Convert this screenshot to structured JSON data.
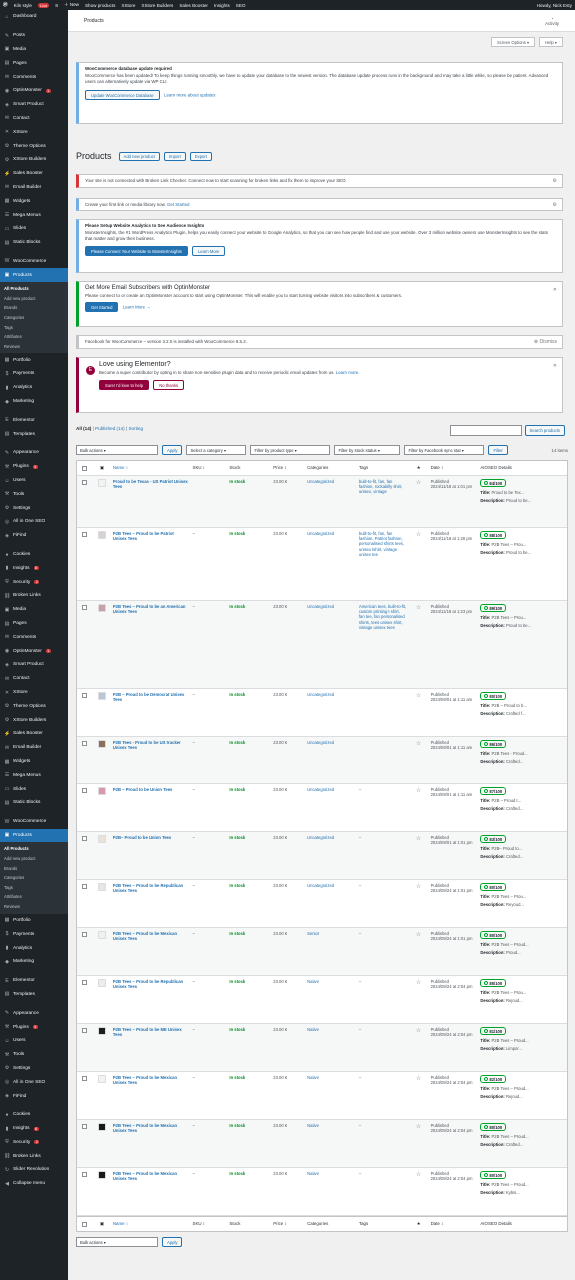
{
  "adminbar": {
    "site": "Kiln style",
    "live": "Live",
    "counts": "8",
    "new": "New",
    "show": "Show products",
    "xstore": "XStore",
    "xstore_builders": "XStore Builders",
    "sales_booster": "Sales Booster",
    "insights": "Insights",
    "seo": "SEO",
    "howdy": "Howdy, Nick Esty"
  },
  "sidebar": {
    "items": [
      {
        "icon": "dashboard-icon",
        "glyph": "⌂",
        "label": "Dashboard"
      },
      {
        "sep": true
      },
      {
        "icon": "pin-icon",
        "glyph": "✎",
        "label": "Posts"
      },
      {
        "icon": "media-icon",
        "glyph": "▣",
        "label": "Media"
      },
      {
        "icon": "pages-icon",
        "glyph": "▤",
        "label": "Pages"
      },
      {
        "icon": "comments-icon",
        "glyph": "✉",
        "label": "Comments"
      },
      {
        "icon": "optinmonster-icon",
        "glyph": "◉",
        "label": "OptinMonster",
        "count": "1"
      },
      {
        "icon": "smart-product-icon",
        "glyph": "◈",
        "label": "Smart Product"
      },
      {
        "icon": "contact-icon",
        "glyph": "✉",
        "label": "Contact"
      },
      {
        "icon": "xstore-icon",
        "glyph": "✕",
        "label": "XStore"
      },
      {
        "icon": "theme-options-icon",
        "glyph": "⚙",
        "label": "Theme Options"
      },
      {
        "icon": "xstore-builders-icon",
        "glyph": "⚙",
        "label": "XStore Builders"
      },
      {
        "icon": "sales-booster-icon",
        "glyph": "⚡",
        "label": "Sales Booster"
      },
      {
        "icon": "email-builder-icon",
        "glyph": "✉",
        "label": "Email Builder"
      },
      {
        "icon": "widgets-icon",
        "glyph": "▦",
        "label": "Widgets"
      },
      {
        "icon": "mega-menu-icon",
        "glyph": "☰",
        "label": "Mega Menus"
      },
      {
        "icon": "slides-icon",
        "glyph": "▭",
        "label": "Slides"
      },
      {
        "icon": "static-blocks-icon",
        "glyph": "▤",
        "label": "Static Blocks"
      },
      {
        "sep": true
      },
      {
        "icon": "woocommerce-icon",
        "glyph": "W",
        "label": "WooCommerce"
      },
      {
        "icon": "products-icon",
        "glyph": "▣",
        "label": "Products",
        "active": true
      }
    ],
    "products_sub": [
      "All Products",
      "Add new product",
      "Brands",
      "Categories",
      "Tags",
      "Attributes",
      "Reviews"
    ],
    "items2": [
      {
        "icon": "portfolio-icon",
        "glyph": "▦",
        "label": "Portfolio"
      },
      {
        "icon": "payments-icon",
        "glyph": "$",
        "label": "Payments"
      },
      {
        "icon": "analytics-icon",
        "glyph": "▮",
        "label": "Analytics"
      },
      {
        "icon": "marketing-icon",
        "glyph": "◆",
        "label": "Marketing"
      },
      {
        "sep": true
      },
      {
        "icon": "elementor-icon",
        "glyph": "E",
        "label": "Elementor"
      },
      {
        "icon": "templates-icon",
        "glyph": "▤",
        "label": "Templates"
      },
      {
        "sep": true
      },
      {
        "icon": "appearance-icon",
        "glyph": "✎",
        "label": "Appearance"
      },
      {
        "icon": "plugins-icon",
        "glyph": "⚒",
        "label": "Plugins",
        "count": "5"
      },
      {
        "icon": "users-icon",
        "glyph": "☺",
        "label": "Users"
      },
      {
        "icon": "tools-icon",
        "glyph": "⚒",
        "label": "Tools"
      },
      {
        "icon": "settings-icon",
        "glyph": "⚙",
        "label": "Settings"
      },
      {
        "icon": "seo-icon",
        "glyph": "◎",
        "label": "All in One SEO"
      },
      {
        "icon": "fifufind-icon",
        "glyph": "◈",
        "label": "FiFind"
      },
      {
        "sep": true
      },
      {
        "icon": "cookies-icon",
        "glyph": "●",
        "label": "Cookies"
      },
      {
        "icon": "insights-icon",
        "glyph": "▮",
        "label": "Insights",
        "count": "8"
      },
      {
        "icon": "security-icon",
        "glyph": "⛨",
        "label": "Security",
        "count": "2"
      },
      {
        "icon": "broken-links-icon",
        "glyph": "⛓",
        "label": "Broken Links"
      },
      {
        "icon": "media2-icon",
        "glyph": "▣",
        "label": "Media"
      },
      {
        "icon": "pages2-icon",
        "glyph": "▤",
        "label": "Pages"
      },
      {
        "icon": "comments2-icon",
        "glyph": "✉",
        "label": "Comments"
      },
      {
        "icon": "optinmonster2-icon",
        "glyph": "◉",
        "label": "OptinMonster",
        "count": "1"
      },
      {
        "icon": "smart-product2-icon",
        "glyph": "◈",
        "label": "Smart Product"
      },
      {
        "icon": "contact2-icon",
        "glyph": "✉",
        "label": "Contact"
      },
      {
        "icon": "xstore2-icon",
        "glyph": "✕",
        "label": "XStore"
      },
      {
        "icon": "theme-options2-icon",
        "glyph": "⚙",
        "label": "Theme Options"
      },
      {
        "icon": "xstore-builders2-icon",
        "glyph": "⚙",
        "label": "XStore Builders"
      },
      {
        "icon": "sales-booster2-icon",
        "glyph": "⚡",
        "label": "Sales Booster"
      },
      {
        "icon": "email-builder2-icon",
        "glyph": "✉",
        "label": "Email Builder"
      },
      {
        "icon": "widgets2-icon",
        "glyph": "▦",
        "label": "Widgets"
      },
      {
        "icon": "mega-menu2-icon",
        "glyph": "☰",
        "label": "Mega Menus"
      },
      {
        "icon": "slides2-icon",
        "glyph": "▭",
        "label": "Slides"
      },
      {
        "icon": "static-blocks2-icon",
        "glyph": "▤",
        "label": "Static Blocks"
      },
      {
        "sep": true
      },
      {
        "icon": "woocommerce2-icon",
        "glyph": "W",
        "label": "WooCommerce"
      },
      {
        "icon": "products2-icon",
        "glyph": "▣",
        "label": "Products",
        "active": true
      }
    ],
    "products_sub2": [
      "All Products",
      "Add new product",
      "Brands",
      "Categories",
      "Tags",
      "Attributes",
      "Reviews"
    ],
    "items3": [
      {
        "icon": "portfolio2-icon",
        "glyph": "▦",
        "label": "Portfolio"
      },
      {
        "icon": "payments2-icon",
        "glyph": "$",
        "label": "Payments"
      },
      {
        "icon": "analytics2-icon",
        "glyph": "▮",
        "label": "Analytics"
      },
      {
        "icon": "marketing2-icon",
        "glyph": "◆",
        "label": "Marketing"
      },
      {
        "sep": true
      },
      {
        "icon": "elementor2-icon",
        "glyph": "E",
        "label": "Elementor"
      },
      {
        "icon": "templates2-icon",
        "glyph": "▤",
        "label": "Templates"
      },
      {
        "sep": true
      },
      {
        "icon": "appearance2-icon",
        "glyph": "✎",
        "label": "Appearance"
      },
      {
        "icon": "plugins2-icon",
        "glyph": "⚒",
        "label": "Plugins",
        "count": "5"
      },
      {
        "icon": "users2-icon",
        "glyph": "☺",
        "label": "Users"
      },
      {
        "icon": "tools2-icon",
        "glyph": "⚒",
        "label": "Tools"
      },
      {
        "icon": "settings2-icon",
        "glyph": "⚙",
        "label": "Settings"
      },
      {
        "icon": "seo2-icon",
        "glyph": "◎",
        "label": "All in One SEO"
      },
      {
        "icon": "fifufind2-icon",
        "glyph": "◈",
        "label": "FiFind"
      },
      {
        "sep": true
      },
      {
        "icon": "cookies2-icon",
        "glyph": "●",
        "label": "Cookies"
      },
      {
        "icon": "insights2-icon",
        "glyph": "▮",
        "label": "Insights",
        "count": "8"
      },
      {
        "icon": "security2-icon",
        "glyph": "⛨",
        "label": "Security",
        "count": "2"
      },
      {
        "icon": "broken-links2-icon",
        "glyph": "⛓",
        "label": "Broken Links"
      },
      {
        "icon": "slider-revolution-icon",
        "glyph": "↻",
        "label": "Slider Revolution"
      },
      {
        "icon": "collapse-icon",
        "glyph": "◀",
        "label": "Collapse menu"
      }
    ]
  },
  "header": {
    "title": "Products",
    "activity": "Activity"
  },
  "screen_options": "Screen Options ▾",
  "help": "Help ▾",
  "notices": {
    "db": {
      "title": "WooCommerce database update required",
      "text": "WooCommerce has been updated! To keep things running smoothly, we have to update your database to the newest version. The database update process runs in the background and may take a little while, so please be patient. Advanced users can alternatively update via WP CLI.",
      "btn1": "Update WooCommerce Database",
      "btn2": "Learn more about updates"
    },
    "broken": {
      "text": "Your site is not connected with Broken Link Checker. Connect now to start scanning for broken links and fix them to improve your SEO."
    },
    "free": {
      "text": "Create your first link or media library now.",
      "link": "Get Started"
    },
    "monsterinsights": {
      "title": "Please Setup Website Analytics to See Audience Insights",
      "text": "MonsterInsights, the #1 WordPress Analytics Plugin, helps you easily connect your website to Google Analytics, so that you can see how people find and use your website. Over 3 million website owners use MonsterInsights to see the stats that matter and grow their business.",
      "btn1": "Please Connect Your Website to MonsterInsights",
      "btn2": "Learn More"
    },
    "optin": {
      "title": "Get More Email Subscribers with OptinMonster",
      "text": "Please connect to or create an OptinMonster account to start using OptinMonster. This will enable you to start turning website visitors into subscribers & customers.",
      "btn1": "Get Started",
      "btn2": "Learn More →"
    },
    "fb": {
      "text": "Facebook for WooCommerce – version 3.2.0 is installed with WooCommerce 8.5.2.",
      "dismiss": "Dismiss"
    },
    "elementor": {
      "title": "Love using Elementor?",
      "text": "Become a super contributor by opting in to share non-sensitive plugin data and to receive periodic email updates from us.",
      "link": "Learn more.",
      "btn1": "Sure! I'd love to help",
      "btn2": "No thanks"
    }
  },
  "page": {
    "title": "Products",
    "add_new": "Add new product",
    "import": "Import",
    "export": "Export"
  },
  "views": {
    "all": "All (14)",
    "sep": "|",
    "published": "Published (14)",
    "sep2": "|",
    "sorting": "Sorting"
  },
  "search_btn": "Search products",
  "filters": {
    "bulk": "Bulk actions",
    "apply": "Apply",
    "category": "Select a category",
    "type": "Filter by product type",
    "stock": "Filter by stock status",
    "fb": "Filter by Facebook sync stat",
    "filter": "Filter",
    "count": "14 items"
  },
  "columns": {
    "name": "Name ↕",
    "sku": "SKU ↕",
    "stock": "Stock",
    "price": "Price ↕",
    "categories": "Categories",
    "tags": "Tags",
    "date": "Date ↕",
    "seo": "AIOSEO Details"
  },
  "products": [
    {
      "name": "Proud to be Texas - US Patriot Unisex Tees",
      "sku": "",
      "stock": "In stock",
      "price": "23.00 €",
      "cat": "Uncategorized",
      "tags": "built-to-fit, fan, fan fashion, rockabilly shirt, unisex, vintage",
      "date_status": "Published",
      "date": "2024/11/18 at 1:01 pm",
      "score": "84/100",
      "title": "Proud to be Tex...",
      "desc": "Proud to be...",
      "thumb": "#f3f3f3"
    },
    {
      "name": "P2B Tees – Proud to be Patriot Unisex Tees",
      "sku": "–",
      "stock": "In stock",
      "price": "23.00 €",
      "cat": "Uncategorized",
      "tags": "built-to-fit, fan, fan fashion, Patriot fashion, personalised shirts tees, unisex tshirt, vintage unisex tee",
      "date_status": "Published",
      "date": "2024/11/18 at 1:26 pm",
      "score": "88/100",
      "title": "P2B Tees – Prou...",
      "desc": "Proud to be...",
      "thumb": "#d9d3cf"
    },
    {
      "name": "P2B Tees – Proud to be an American Unisex Tees",
      "sku": "–",
      "stock": "In stock",
      "price": "23.00 €",
      "cat": "Uncategorized",
      "tags": "American tees, built-to-fit, custom printing t shirt, fan tee, fan personalised shirts, tees unisex shirt, vintage unisex tees",
      "date_status": "Published",
      "date": "2024/11/18 at 1:23 pm",
      "score": "89/100",
      "title": "P2B Tees – Prou...",
      "desc": "Proud to be...",
      "thumb": "#c9a0a8"
    },
    {
      "name": "P2B – Proud to be Democrat Unisex Tees",
      "sku": "–",
      "stock": "In stock",
      "price": "23.00 €",
      "cat": "Uncategorized",
      "tags": "",
      "date_status": "Published",
      "date": "2024/09/01 at 1:11 am",
      "score": "80/100",
      "title": "P2B – Proud to b...",
      "desc": "Crafted f...",
      "thumb": "#b8c8d8"
    },
    {
      "name": "P2B Tees - Proud to be US trucker Unisex Tees",
      "sku": "–",
      "stock": "In stock",
      "price": "23.00 €",
      "cat": "Uncategorized",
      "tags": "",
      "date_status": "Published",
      "date": "2024/09/01 at 1:11 am",
      "score": "86/100",
      "title": "P2B Tees - Proud...",
      "desc": "Crafted...",
      "thumb": "#8a7058"
    },
    {
      "name": "P2B – Proud to be Union Tees",
      "sku": "–",
      "stock": "In stock",
      "price": "23.00 €",
      "cat": "Uncategorized",
      "tags": "–",
      "date_status": "Published",
      "date": "2024/09/01 at 1:11 am",
      "score": "87/100",
      "title": "P2B – Proud t...",
      "desc": "Crafted...",
      "thumb": "#d89aa8"
    },
    {
      "name": "P2B– Proud to be Union Tees",
      "sku": "–",
      "stock": "In stock",
      "price": "23.00 €",
      "cat": "Uncategorized",
      "tags": "–",
      "date_status": "Published",
      "date": "2024/09/01 at 1:01 pm",
      "score": "83/100",
      "title": "P2B– Proud to...",
      "desc": "Crafted...",
      "thumb": "#e8e2d8"
    },
    {
      "name": "P2B Tees – Proud to be Republican Unisex Tees",
      "sku": "–",
      "stock": "In stock",
      "price": "23.00 €",
      "cat": "Uncategorized",
      "tags": "–",
      "date_status": "Published",
      "date": "2024/09/24 at 1:01 pm",
      "score": "80/100",
      "title": "P2B Tees – Prou...",
      "desc": "Reyoud...",
      "thumb": "#e6e6e6"
    },
    {
      "name": "P2B Tees – Proud to be Mexican Unisex Tees",
      "sku": "–",
      "stock": "In stock",
      "price": "23.00 €",
      "cat": "Senior",
      "tags": "–",
      "date_status": "Published",
      "date": "2024/09/24 at 1:01 pm",
      "score": "80/100",
      "title": "P2B Tees – Proud...",
      "desc": "Proud...",
      "thumb": "#f0f0f0"
    },
    {
      "name": "P2B Tees – Proud to be Republican Unisex Tees",
      "sku": "–",
      "stock": "In stock",
      "price": "23.00 €",
      "cat": "Native",
      "tags": "–",
      "date_status": "Published",
      "date": "2024/09/24 at 2:04 pm",
      "score": "85/100",
      "title": "P2B Tees – Prou...",
      "desc": "Rejoud...",
      "thumb": "#ececec"
    },
    {
      "name": "P2B Tees – Proud to be ME Unisex Tees",
      "sku": "–",
      "stock": "In stock",
      "price": "23.00 €",
      "cat": "Native",
      "tags": "–",
      "date_status": "Published",
      "date": "2024/09/24 at 2:04 pm",
      "score": "81/100",
      "title": "P2B Tees – Proud...",
      "desc": "Limpor...",
      "thumb": "#1d1d1d"
    },
    {
      "name": "P2B Tees – Proud to be Mexican Unisex Tees",
      "sku": "–",
      "stock": "In stock",
      "price": "23.00 €",
      "cat": "Native",
      "tags": "–",
      "date_status": "Published",
      "date": "2024/09/24 at 2:04 pm",
      "score": "82/100",
      "title": "P2B Tees – Proud...",
      "desc": "Rejoud...",
      "thumb": "#f2f2f2"
    },
    {
      "name": "P2B Tees – Proud to be Mexican Unisex Tees",
      "sku": "–",
      "stock": "In stock",
      "price": "23.00 €",
      "cat": "Native",
      "tags": "–",
      "date_status": "Published",
      "date": "2024/09/24 at 2:04 pm",
      "score": "80/100",
      "title": "P2B Tees – Proud...",
      "desc": "Crafted...",
      "thumb": "#1a1a1a"
    },
    {
      "name": "P2B Tees – Proud to be Mexican Unisex Tees",
      "sku": "–",
      "stock": "In stock",
      "price": "23.00 €",
      "cat": "Native",
      "tags": "–",
      "date_status": "Published",
      "date": "2024/09/24 at 2:04 pm",
      "score": "80/100",
      "title": "P2B Tees – Proud...",
      "desc": "Kybis...",
      "thumb": "#1a1a1a"
    }
  ],
  "seo_labels": {
    "title": "Title:",
    "desc": "Description:"
  },
  "bottom": {
    "bulk": "Bulk actions",
    "apply": "Apply"
  }
}
